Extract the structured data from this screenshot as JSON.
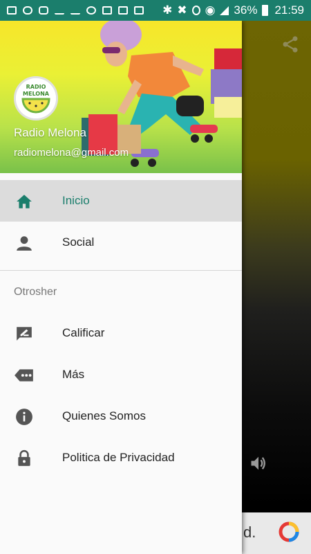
{
  "status_bar": {
    "battery": "36%",
    "time": "21:59"
  },
  "drawer": {
    "header": {
      "app_name": "Radio Melona",
      "email": "radiomelona@gmail.com",
      "logo_text": [
        "RADIO",
        "MELONA"
      ]
    },
    "items": [
      {
        "label": "Inicio",
        "icon": "home-icon",
        "active": true
      },
      {
        "label": "Social",
        "icon": "person-icon",
        "active": false
      }
    ],
    "section_title": "Otrosher",
    "other_items": [
      {
        "label": "Calificar",
        "icon": "rate-review-icon"
      },
      {
        "label": "Más",
        "icon": "more-icon"
      },
      {
        "label": "Quienes Somos",
        "icon": "info-icon"
      },
      {
        "label": "Politica de Privacidad",
        "icon": "lock-icon"
      }
    ]
  },
  "background_app": {
    "ad_text_fragment": "d."
  },
  "colors": {
    "status_bar": "#1b7e6c",
    "accent": "#1b7e6c",
    "active_row": "#dcdcdc",
    "icon_gray": "#555555"
  }
}
